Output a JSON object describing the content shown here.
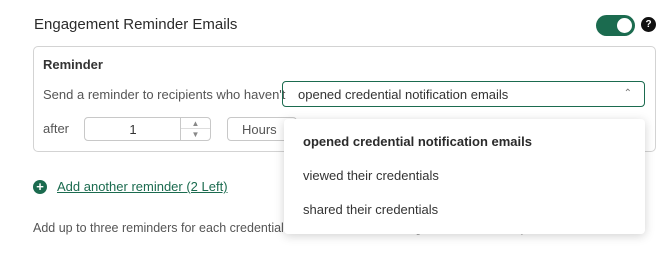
{
  "section": {
    "title": "Engagement Reminder Emails",
    "toggle_on": true,
    "help_icon": "?"
  },
  "reminder": {
    "title": "Reminder",
    "sentence": "Send a reminder to recipients who haven't",
    "condition_value": "opened credential notification emails",
    "after_label": "after",
    "quantity": "1",
    "unit": "Hours"
  },
  "dropdown": {
    "options": [
      "opened credential notification emails",
      "viewed their credentials",
      "shared their credentials"
    ],
    "selected_index": 0
  },
  "add_reminder": {
    "icon": "plus-circle-icon",
    "label": "Add another reminder (2 Left)"
  },
  "help_text": "Add up to three reminders for each credential. T… selected rule, using default email template.",
  "colors": {
    "accent": "#1b6b4f",
    "border": "#d3d3d3"
  }
}
